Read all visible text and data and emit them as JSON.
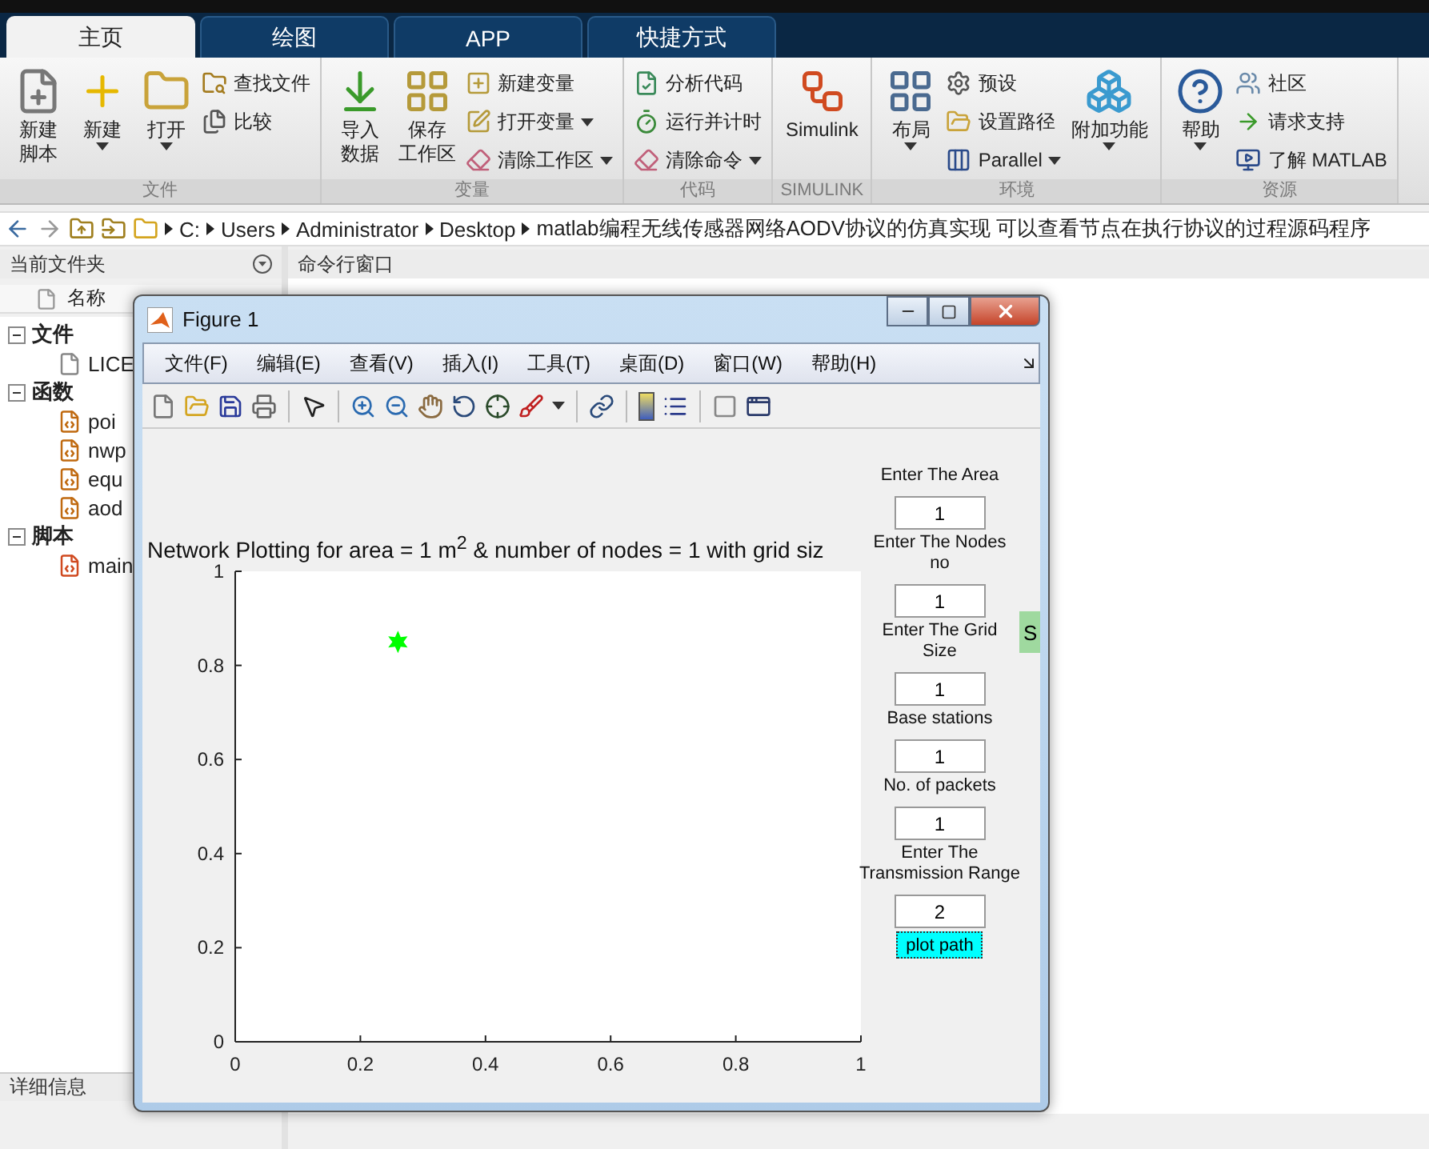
{
  "tabs": [
    {
      "label": "主页",
      "selected": true
    },
    {
      "label": "绘图",
      "selected": false
    },
    {
      "label": "APP",
      "selected": false
    },
    {
      "label": "快捷方式",
      "selected": false
    }
  ],
  "ribbon": [
    {
      "label": "文件",
      "items": [
        {
          "kind": "large",
          "lines": [
            "新建",
            "脚本"
          ],
          "dropdown": false
        },
        {
          "kind": "large",
          "lines": [
            "新建"
          ],
          "dropdown": true
        },
        {
          "kind": "large",
          "lines": [
            "打开"
          ],
          "dropdown": true
        },
        {
          "kind": "stack",
          "items": [
            {
              "label": "查找文件",
              "dropdown": false
            },
            {
              "label": "比较",
              "dropdown": false
            }
          ]
        }
      ]
    },
    {
      "label": "变量",
      "items": [
        {
          "kind": "large",
          "lines": [
            "导入",
            "数据"
          ],
          "dropdown": false
        },
        {
          "kind": "large",
          "lines": [
            "保存",
            "工作区"
          ],
          "dropdown": false
        },
        {
          "kind": "stack",
          "items": [
            {
              "label": "新建变量",
              "dropdown": false
            },
            {
              "label": "打开变量",
              "dropdown": true
            },
            {
              "label": "清除工作区",
              "dropdown": true
            }
          ]
        }
      ]
    },
    {
      "label": "代码",
      "items": [
        {
          "kind": "stack",
          "items": [
            {
              "label": "分析代码",
              "dropdown": false
            },
            {
              "label": "运行并计时",
              "dropdown": false
            },
            {
              "label": "清除命令",
              "dropdown": true
            }
          ]
        }
      ]
    },
    {
      "label": "SIMULINK",
      "items": [
        {
          "kind": "large",
          "lines": [
            "Simulink"
          ],
          "dropdown": false
        }
      ]
    },
    {
      "label": "环境",
      "items": [
        {
          "kind": "large",
          "lines": [
            "布局"
          ],
          "dropdown": true
        },
        {
          "kind": "stack",
          "items": [
            {
              "label": "预设",
              "dropdown": false
            },
            {
              "label": "设置路径",
              "dropdown": false
            },
            {
              "label": "Parallel",
              "dropdown": true
            }
          ]
        },
        {
          "kind": "large",
          "lines": [
            "附加功能"
          ],
          "dropdown": true
        }
      ]
    },
    {
      "label": "资源",
      "items": [
        {
          "kind": "large",
          "lines": [
            "帮助"
          ],
          "dropdown": true
        },
        {
          "kind": "stack",
          "items": [
            {
              "label": "社区",
              "dropdown": false
            },
            {
              "label": "请求支持",
              "dropdown": false
            },
            {
              "label": "了解 MATLAB",
              "dropdown": false
            }
          ]
        }
      ]
    }
  ],
  "address": [
    "C:",
    "Users",
    "Administrator",
    "Desktop",
    "matlab编程无线传感器网络AODV协议的仿真实现 可以查看节点在执行协议的过程源码程序"
  ],
  "folder_panel": {
    "title": "当前文件夹",
    "column": "名称",
    "tree": [
      {
        "label": "文件",
        "expanded": true,
        "children": [
          {
            "label": "LICE",
            "kind": "file"
          }
        ]
      },
      {
        "label": "函数",
        "expanded": true,
        "children": [
          {
            "label": "poi",
            "kind": "function"
          },
          {
            "label": "nwp",
            "kind": "function"
          },
          {
            "label": "equ",
            "kind": "function"
          },
          {
            "label": "aod",
            "kind": "function"
          }
        ]
      },
      {
        "label": "脚本",
        "expanded": true,
        "children": [
          {
            "label": "main",
            "kind": "script"
          }
        ]
      }
    ],
    "details": "详细信息"
  },
  "command_window": {
    "title": "命令行窗口"
  },
  "figure": {
    "title": "Figure 1",
    "menu": [
      "文件(F)",
      "编辑(E)",
      "查看(V)",
      "插入(I)",
      "工具(T)",
      "桌面(D)",
      "窗口(W)",
      "帮助(H)"
    ],
    "chart_data": {
      "type": "scatter",
      "title": "Network Plotting for area = 1 m$^{2}$ & number of nodes = 1 with grid siz",
      "xlim": [
        0,
        1
      ],
      "ylim": [
        0,
        1
      ],
      "xticks": [
        0,
        0.2,
        0.4,
        0.6,
        0.8,
        1
      ],
      "yticks": [
        0,
        0.2,
        0.4,
        0.6,
        0.8,
        1
      ],
      "x": [
        0.26
      ],
      "series": [
        {
          "color": "#00ff00",
          "values": [
            0.85
          ]
        }
      ]
    },
    "controls": [
      {
        "label": "Enter The Area",
        "value": "1"
      },
      {
        "label": "Enter The Nodes\nno",
        "value": "1"
      },
      {
        "label": "Enter The Grid\nSize",
        "value": "1"
      },
      {
        "label": "Base stations",
        "value": "1"
      },
      {
        "label": "No. of packets",
        "value": "1"
      },
      {
        "label": "Enter The\nTransmission Range",
        "value": "2"
      }
    ],
    "plot_button": "plot path",
    "side_button": "S"
  }
}
